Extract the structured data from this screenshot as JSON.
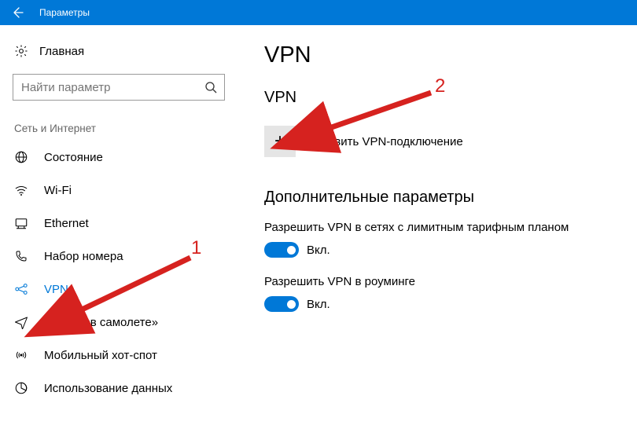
{
  "window": {
    "title": "Параметры"
  },
  "sidebar": {
    "home_label": "Главная",
    "search_placeholder": "Найти параметр",
    "section_label": "Сеть и Интернет",
    "items": [
      {
        "label": "Состояние"
      },
      {
        "label": "Wi-Fi"
      },
      {
        "label": "Ethernet"
      },
      {
        "label": "Набор номера"
      },
      {
        "label": "VPN"
      },
      {
        "label": "Режим «в самолете»"
      },
      {
        "label": "Мобильный хот-спот"
      },
      {
        "label": "Использование данных"
      }
    ]
  },
  "main": {
    "page_title": "VPN",
    "vpn_section_title": "VPN",
    "add_vpn_label": "Добавить VPN-подключение",
    "advanced_title": "Дополнительные параметры",
    "setting1": {
      "label": "Разрешить VPN в сетях с лимитным тарифным планом",
      "state_text": "Вкл."
    },
    "setting2": {
      "label": "Разрешить VPN в роуминге",
      "state_text": "Вкл."
    }
  },
  "annotations": {
    "label1": "1",
    "label2": "2"
  },
  "colors": {
    "accent": "#0078d7",
    "annotation": "#d6221f"
  }
}
